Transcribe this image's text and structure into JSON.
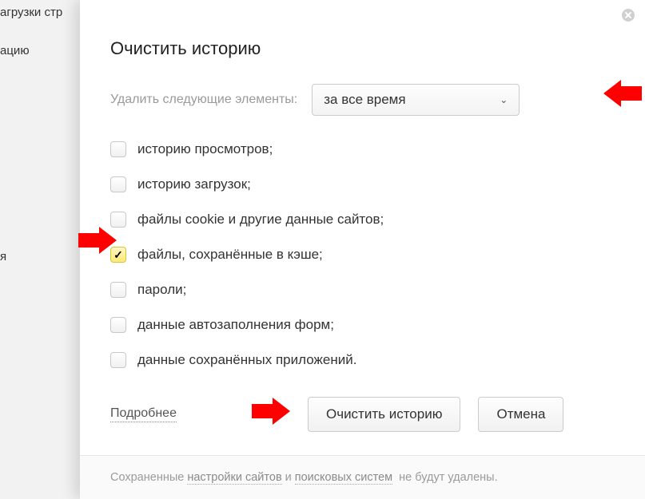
{
  "background": {
    "line1": "агрузки стр",
    "line2": "ацию",
    "line3": "я"
  },
  "dialog": {
    "title": "Очистить историю",
    "range": {
      "label": "Удалить следующие элементы:",
      "selected": "за все время"
    },
    "options": [
      {
        "label": "историю просмотров;",
        "checked": false
      },
      {
        "label": "историю загрузок;",
        "checked": false
      },
      {
        "label": "файлы cookie и другие данные сайтов;",
        "checked": false
      },
      {
        "label": "файлы, сохранённые в кэше;",
        "checked": true
      },
      {
        "label": "пароли;",
        "checked": false
      },
      {
        "label": "данные автозаполнения форм;",
        "checked": false
      },
      {
        "label": "данные сохранённых приложений.",
        "checked": false
      }
    ],
    "more_link": "Подробнее",
    "buttons": {
      "clear": "Очистить историю",
      "cancel": "Отмена"
    },
    "footer": {
      "pre": "Сохраненные",
      "link1": "настройки сайтов",
      "mid": "и",
      "link2": "поисковых систем",
      "post": "не будут удалены."
    }
  }
}
